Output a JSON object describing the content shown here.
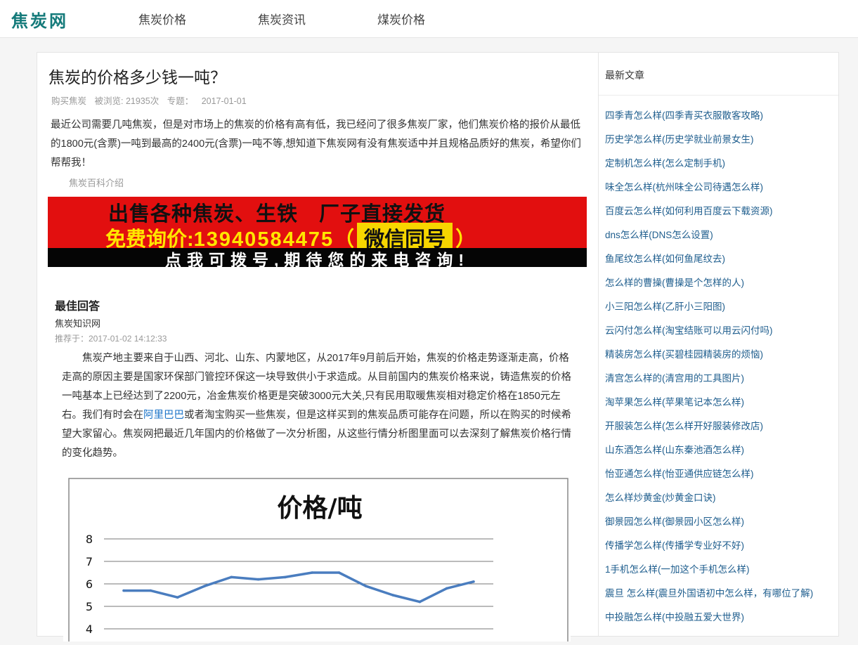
{
  "header": {
    "logo": "焦炭网",
    "nav": [
      "焦炭价格",
      "焦炭资讯",
      "煤炭价格"
    ]
  },
  "article": {
    "title": "焦炭的价格多少钱一吨？",
    "meta": {
      "category": "购买焦炭",
      "views": "被浏览: 21935次",
      "topic": "专题：",
      "date": "2017-01-01"
    },
    "question": "最近公司需要几吨焦炭，但是对市场上的焦炭的价格有高有低，我已经问了很多焦炭厂家，他们焦炭价格的报价从最低的1800元(含票)一吨到最高的2400元(含票)一吨不等,想知道下焦炭网有没有焦炭适中并且规格品质好的焦炭，希望你们帮帮我！",
    "tag": "焦炭百科介绍",
    "banner": {
      "line1": "出售各种焦炭、生铁　厂子直接发货",
      "line2_prefix": "免费询价:",
      "line2_phone": "13940584475",
      "line2_open": "（",
      "line2_wechat": "微信同号",
      "line2_close": "）",
      "line3": "点我可拨号,期待您的来电咨询!"
    },
    "answer": {
      "heading": "最佳回答",
      "source": "焦炭知识网",
      "recommended": "推荐于：2017-01-02 14:12:33",
      "text_part1": "焦炭产地主要来自于山西、河北、山东、内蒙地区，从2017年9月前后开始，焦炭的价格走势逐渐走高，价格走高的原因主要是国家环保部门管控环保这一块导致供小于求造成。从目前国内的焦炭价格来说，铸造焦炭的价格一吨基本上已经达到了2200元，冶金焦炭价格更是突破3000元大关,只有民用取暖焦炭相对稳定价格在1850元左右。我们有时会在",
      "link": "阿里巴巴",
      "text_part2": "或者淘宝购买一些焦炭，但是这样买到的焦炭品质可能存在问题，所以在购买的时候希望大家留心。焦炭网把最近几年国内的价格做了一次分析图，从这些行情分析图里面可以去深刻了解焦炭价格行情的变化趋势。"
    }
  },
  "chart_data": {
    "type": "line",
    "title": "价格/吨",
    "y_ticks": [
      "8",
      "7",
      "6",
      "5",
      "4"
    ],
    "ylim": [
      4,
      8
    ],
    "x": [
      1,
      2,
      3,
      4,
      5,
      6,
      7,
      8,
      9,
      10,
      11,
      12,
      13,
      14
    ],
    "values": [
      5.7,
      5.7,
      5.4,
      5.9,
      6.3,
      6.2,
      6.3,
      6.5,
      6.5,
      5.9,
      5.5,
      5.2,
      5.8,
      6.1
    ],
    "series_color": "#4a7dbf",
    "grid": true
  },
  "sidebar": {
    "title": "最新文章",
    "items": [
      "四季青怎么样(四季青买衣服散客攻略)",
      "历史学怎么样(历史学就业前景女生)",
      "定制机怎么样(怎么定制手机)",
      "味全怎么样(杭州味全公司待遇怎么样)",
      "百度云怎么样(如何利用百度云下载资源)",
      "dns怎么样(DNS怎么设置)",
      "鱼尾纹怎么样(如何鱼尾纹去)",
      "怎么样的曹操(曹操是个怎样的人)",
      "小三阳怎么样(乙肝小三阳图)",
      "云闪付怎么样(淘宝结账可以用云闪付吗)",
      "精装房怎么样(买碧桂园精装房的烦恼)",
      "清宫怎么样的(清宫用的工具图片)",
      "淘苹果怎么样(苹果笔记本怎么样)",
      "开服装怎么样(怎么样开好服装修改店)",
      "山东酒怎么样(山东秦池酒怎么样)",
      "怡亚通怎么样(怡亚通供应链怎么样)",
      "怎么样炒黄金(炒黄金口诀)",
      "御景园怎么样(御景园小区怎么样)",
      "传播学怎么样(传播学专业好不好)",
      "1手机怎么样(一加这个手机怎么样)",
      "震旦 怎么样(震旦外国语初中怎么样，有哪位了解)",
      "中投融怎么样(中投融五爱大世界)"
    ]
  }
}
